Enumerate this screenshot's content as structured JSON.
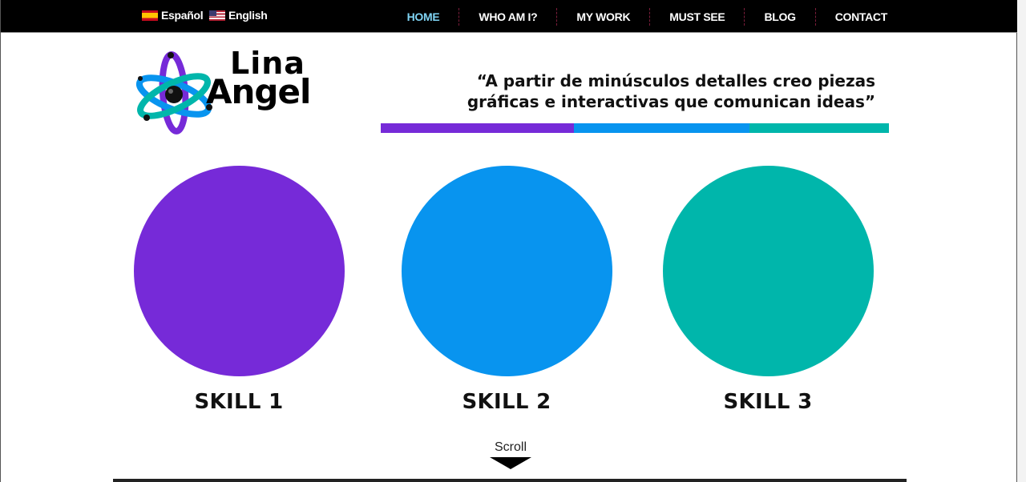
{
  "languages": [
    {
      "label": "Español",
      "flag": "spain-flag-icon"
    },
    {
      "label": "English",
      "flag": "us-flag-icon"
    }
  ],
  "nav": {
    "items": [
      "HOME",
      "WHO AM I?",
      "MY WORK",
      "MUST SEE",
      "BLOG",
      "CONTACT"
    ],
    "active": "HOME",
    "active_color": "#7fd3f3"
  },
  "logo": {
    "line1": "Lina",
    "line2": "Angel",
    "icon": "atom-logo-icon"
  },
  "tagline": {
    "line1": "“A partir de minúsculos detalles creo piezas",
    "line2": "gráficas e interactivas que comunican ideas”"
  },
  "colors": {
    "purple": "#762ad8",
    "blue": "#0894ef",
    "teal": "#00b6ab"
  },
  "colorbar": {
    "segments": [
      {
        "color": "#762ad8",
        "share": 0.38
      },
      {
        "color": "#0894ef",
        "share": 0.345
      },
      {
        "color": "#00b6ab",
        "share": 0.275
      }
    ]
  },
  "skills": [
    {
      "label": "SKILL 1",
      "color": "#762ad8"
    },
    {
      "label": "SKILL 2",
      "color": "#0894ef"
    },
    {
      "label": "SKILL 3",
      "color": "#00b6ab"
    }
  ],
  "scroll": {
    "label": "Scroll",
    "icon": "arrow-down-icon"
  }
}
